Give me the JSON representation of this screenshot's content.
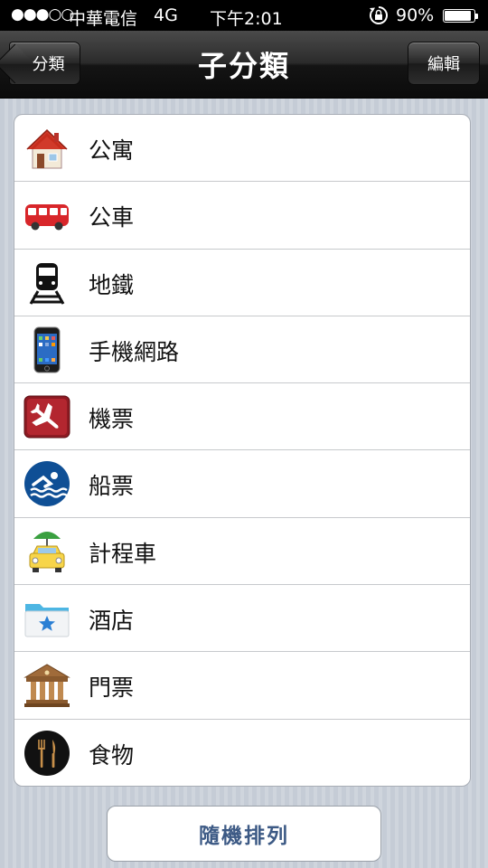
{
  "status_bar": {
    "signal": "●●●○○",
    "carrier": "中華電信",
    "network": "4G",
    "time": "下午2:01",
    "lock_icon": "rotation-lock-icon",
    "battery_percent": "90%",
    "battery_level": 0.9
  },
  "nav": {
    "back_label": "分類",
    "title": "子分類",
    "edit_label": "編輯"
  },
  "list": {
    "items": [
      {
        "label": "公寓",
        "icon": "house-icon"
      },
      {
        "label": "公車",
        "icon": "bus-icon"
      },
      {
        "label": "地鐵",
        "icon": "metro-train-icon"
      },
      {
        "label": "手機網路",
        "icon": "smartphone-icon"
      },
      {
        "label": "機票",
        "icon": "airplane-icon"
      },
      {
        "label": "船票",
        "icon": "swimmer-waves-icon"
      },
      {
        "label": "計程車",
        "icon": "taxi-icon"
      },
      {
        "label": "酒店",
        "icon": "folder-star-icon"
      },
      {
        "label": "門票",
        "icon": "museum-icon"
      },
      {
        "label": "食物",
        "icon": "fork-knife-icon"
      }
    ]
  },
  "bottom": {
    "shuffle_label": "隨機排列"
  }
}
